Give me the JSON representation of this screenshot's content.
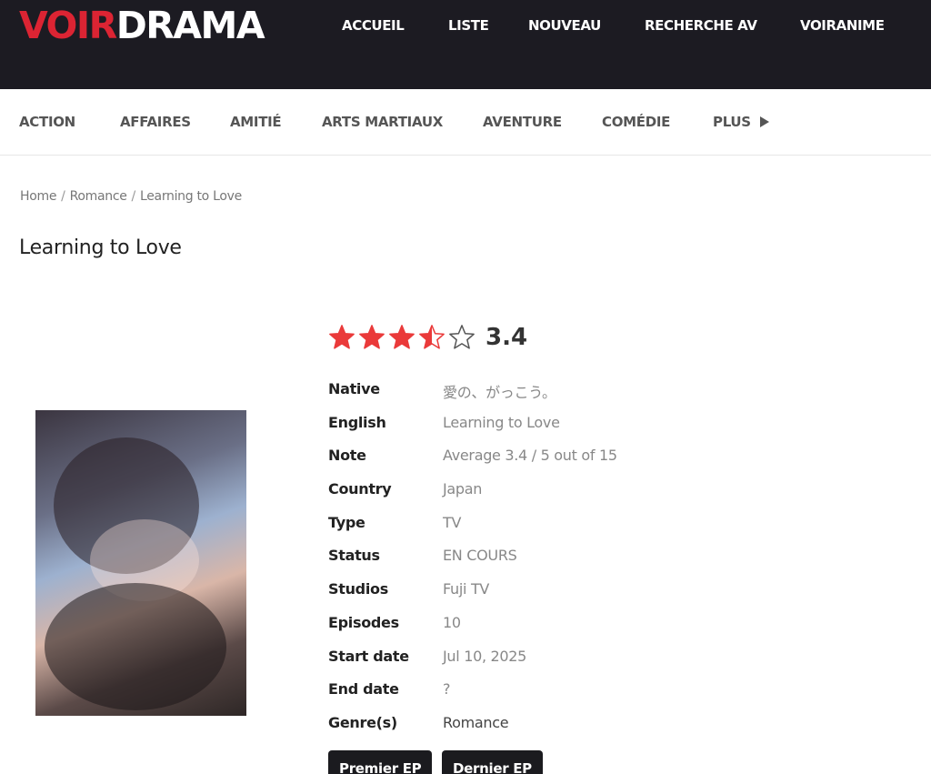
{
  "logo": {
    "part1": "VOIR",
    "part2": "DRAMA"
  },
  "main_nav": [
    "ACCUEIL",
    "LISTE",
    "NOUVEAU",
    "RECHERCHE AV",
    "VOIRANIME"
  ],
  "genre_nav": [
    "ACTION",
    "AFFAIRES",
    "AMITIÉ",
    "ARTS MARTIAUX",
    "AVENTURE",
    "COMÉDIE",
    "PLUS"
  ],
  "breadcrumb": {
    "home": "Home",
    "category": "Romance",
    "current": "Learning to Love",
    "separator": "/"
  },
  "title": "Learning to Love",
  "rating": {
    "value": "3.4",
    "stars_filled": 3.5,
    "stars_total": 5
  },
  "info": {
    "native_label": "Native",
    "native": "愛の、がっこう。",
    "english_label": "English",
    "english": "Learning to Love",
    "note_label": "Note",
    "note": "Average 3.4 / 5 out of 15",
    "country_label": "Country",
    "country": "Japan",
    "type_label": "Type",
    "type": "TV",
    "status_label": "Status",
    "status": "EN COURS",
    "studios_label": "Studios",
    "studios": "Fuji TV",
    "episodes_label": "Episodes",
    "episodes": "10",
    "start_label": "Start date",
    "start": "Jul 10, 2025",
    "end_label": "End date",
    "end": "?",
    "genres_label": "Genre(s)",
    "genres": "Romance"
  },
  "buttons": {
    "first": "Premier EP",
    "last": "Dernier EP"
  },
  "colors": {
    "brand_red": "#dc2433",
    "header_bg": "#1c1b22",
    "star_color": "#ea3a3a"
  }
}
